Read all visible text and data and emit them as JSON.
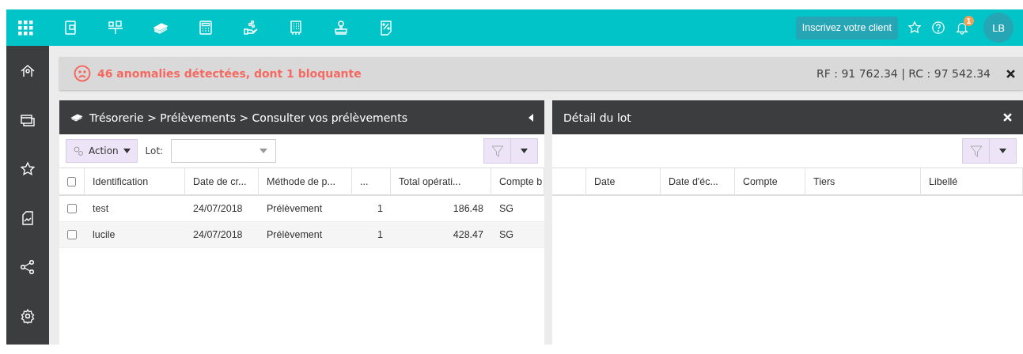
{
  "topbar": {
    "client_button": "Inscrivez votre client",
    "notification_count": "1",
    "avatar": "LB"
  },
  "alert": {
    "message": "46 anomalies détectées, dont 1 bloquante",
    "totals": "RF : 91 762.34 | RC : 97 542.34"
  },
  "left_panel": {
    "title": "Trésorerie > Prélèvements > Consulter vos prélèvements",
    "action_button": "Action",
    "lot_label": "Lot:",
    "select_all_checked": false,
    "columns": [
      "Identification",
      "Date de cr...",
      "Méthode de p...",
      "...",
      "Total opérati...",
      "Compte b"
    ],
    "rows": [
      {
        "checked": false,
        "cells": [
          "test",
          "24/07/2018",
          "Prélèvement",
          "1",
          "186.48",
          "SG"
        ]
      },
      {
        "checked": false,
        "cells": [
          "lucile",
          "24/07/2018",
          "Prélèvement",
          "1",
          "428.47",
          "SG"
        ]
      }
    ]
  },
  "right_panel": {
    "title": "Détail du lot",
    "columns": [
      "Date",
      "Date d'éc...",
      "Compte",
      "Tiers",
      "Libellé"
    ]
  }
}
